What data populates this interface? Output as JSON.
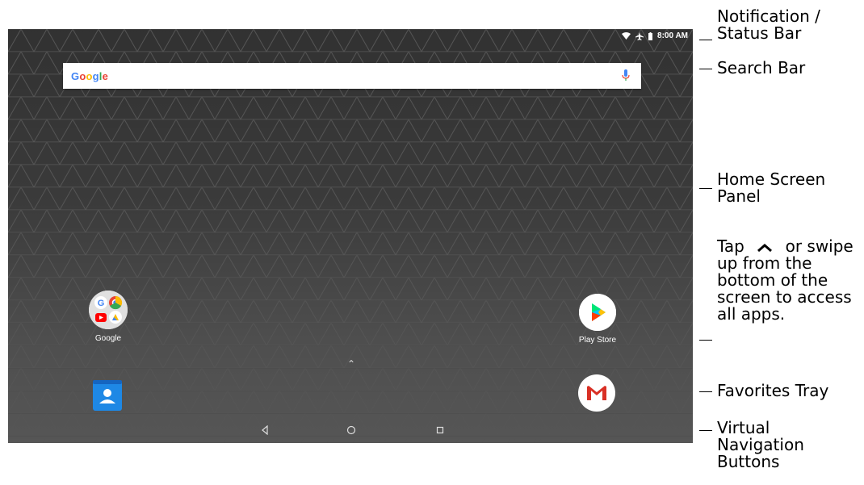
{
  "status_bar": {
    "time": "8:00 AM",
    "icons": [
      "wifi-icon",
      "airplane-icon",
      "battery-icon"
    ]
  },
  "search_bar": {
    "logo_text": "Google",
    "mic_icon": "mic-icon"
  },
  "home_screen": {
    "apps": [
      {
        "label": "Google",
        "icon": "google-folder-icon"
      },
      {
        "label": "Play Store",
        "icon": "play-store-icon"
      }
    ],
    "favorites": [
      {
        "icon": "contacts-icon"
      },
      {
        "icon": "gmail-icon"
      }
    ],
    "app_drawer_hint_icon": "chevron-up-icon"
  },
  "navigation": {
    "buttons": [
      "back-icon",
      "home-icon",
      "recents-icon"
    ]
  },
  "callouts": {
    "status_bar": "Notification / Status Bar",
    "search_bar": "Search Bar",
    "home_panel": "Home Screen Panel",
    "tap_1": "Tap",
    "tap_2": "or",
    "tap_3": "swipe up from the bottom of the screen to access all apps.",
    "favorites": "Favorites Tray",
    "nav_buttons": "Virtual Navigation Buttons"
  },
  "colors": {
    "screen_bg": "#3a3a3a",
    "gmail_red": "#D93025",
    "contacts_blue": "#1E88E5"
  }
}
